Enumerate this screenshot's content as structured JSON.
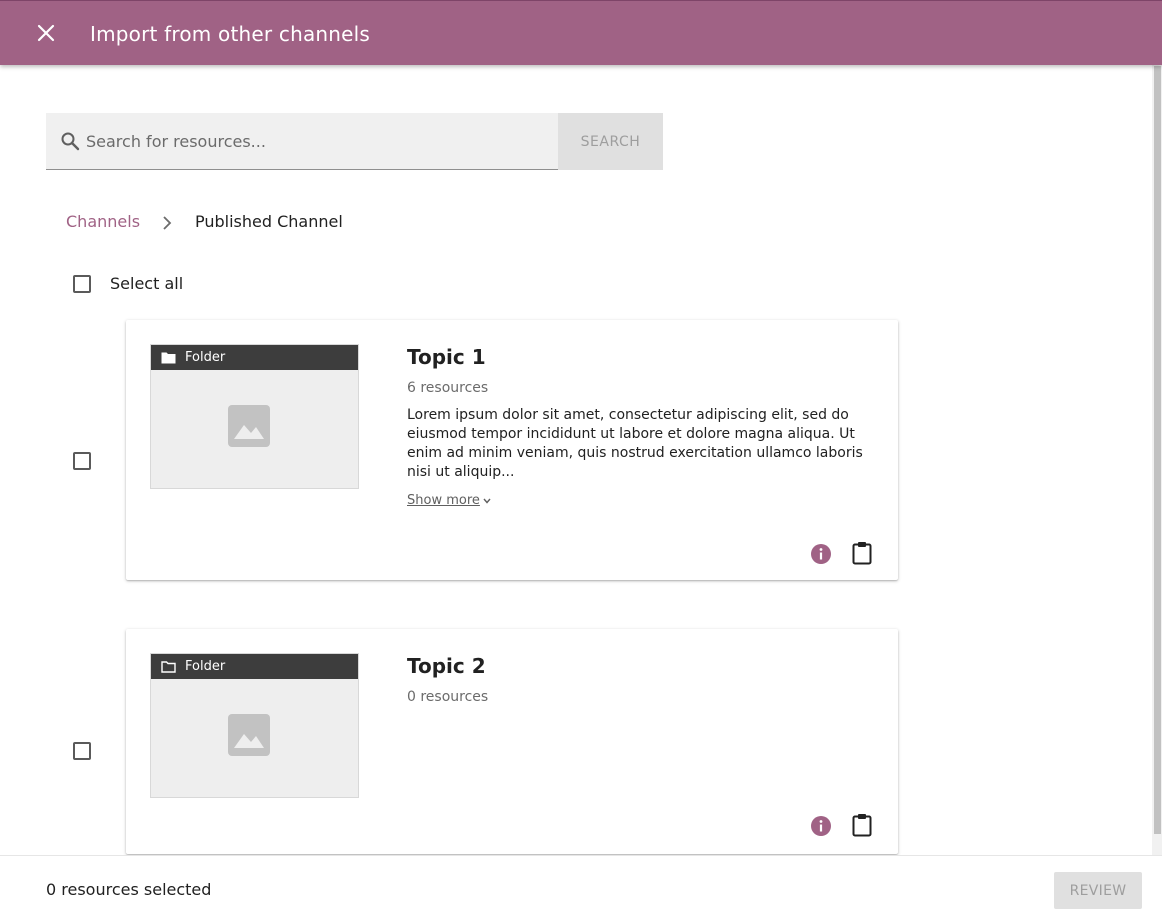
{
  "app_bar": {
    "title": "Import from other channels",
    "close_icon": "close-icon",
    "color": "#a06285"
  },
  "search": {
    "placeholder": "Search for resources...",
    "value": "",
    "button_label": "SEARCH"
  },
  "breadcrumb": {
    "items": [
      "Channels",
      "Published Channel"
    ]
  },
  "select_all_label": "Select all",
  "cards": [
    {
      "thumbnail_label": "Folder",
      "title": "Topic 1",
      "count": "6 resources",
      "description": "Lorem ipsum dolor sit amet, consectetur adipiscing elit, sed do eiusmod tempor incididunt ut labore et dolore magna aliqua. Ut enim ad minim veniam, quis nostrud exercitation ullamco laboris nisi ut aliquip...",
      "show_more": "Show more"
    },
    {
      "thumbnail_label": "Folder",
      "title": "Topic 2",
      "count": "0 resources"
    }
  ],
  "footer": {
    "selected_count": "0 resources selected",
    "review_label": "REVIEW"
  },
  "colors": {
    "accent": "#a06285",
    "thumb_bar": "#3d3d3d",
    "disabled_button": "#e0e0e0"
  }
}
